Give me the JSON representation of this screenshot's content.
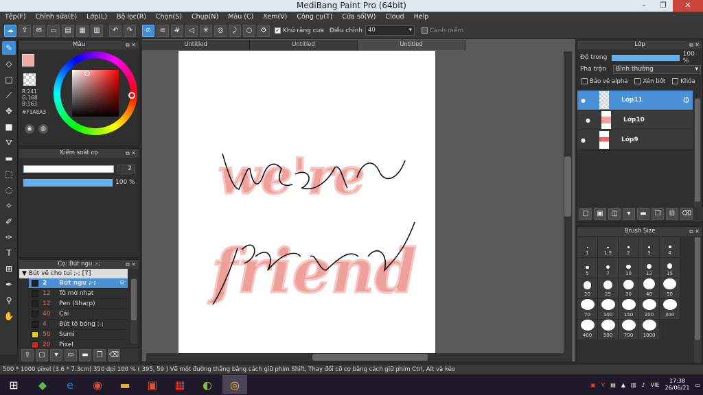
{
  "window": {
    "title": "MediBang Paint Pro (64bit)",
    "min": "–",
    "max": "❐",
    "close": "✕"
  },
  "menu": [
    "Tệp(F)",
    "Chỉnh sửa(E)",
    "Lớp(L)",
    "Bộ lọc(R)",
    "Chọn(S)",
    "Chụp(N)",
    "Màu (C)",
    "Xem(V)",
    "Công cụ(T)",
    "Cửa sổ(W)",
    "Cloud",
    "Help"
  ],
  "toolbar": {
    "antialias": "Khử răng cưa",
    "adjust": "Điều chỉnh",
    "adjust_value": "40",
    "guide": "Canh mềm"
  },
  "color_panel": {
    "title": "Màu",
    "r": "R:241",
    "g": "G:168",
    "b": "B:163",
    "hex": "#F1A8A3",
    "main_color": "#f1a8a3"
  },
  "brush_control": {
    "title": "Kiểm soát cọ",
    "size": "2",
    "opacity": "100 %"
  },
  "brush_panel": {
    "title": "Cọ: Bút ngu ;-;",
    "group": "Bút vẽ cho tui ;-; [7]",
    "items": [
      {
        "size": "2",
        "name": "Bút ngu ;-;",
        "color": "#222222"
      },
      {
        "size": "12",
        "name": "Tô mờ nhạt",
        "color": "#222222"
      },
      {
        "size": "12",
        "name": "Pen (Sharp)",
        "color": "#222222"
      },
      {
        "size": "40",
        "name": "Cái",
        "color": "#222222"
      },
      {
        "size": "4",
        "name": "Bút tô bóng ;-;",
        "color": "#222222"
      },
      {
        "size": "50",
        "name": "Sumi",
        "color": "#e8d000"
      },
      {
        "size": "20",
        "name": "Pixel",
        "color": "#d02020"
      }
    ]
  },
  "doc_tabs": [
    "Untitled",
    "Untitled",
    "Untitled"
  ],
  "artwork": {
    "line1": "we're",
    "line2": "friend"
  },
  "layer_panel": {
    "title": "Lớp",
    "opacity_label": "Độ trong",
    "opacity_value": "100 %",
    "blend_label": "Pha trộn",
    "blend_value": "Bình thường",
    "protect_alpha": "Bảo vệ alpha",
    "clip": "Xén bớt",
    "lock": "Khóa",
    "layers": [
      {
        "name": "Lớp11"
      },
      {
        "name": "Lớp10"
      },
      {
        "name": "Lớp9"
      }
    ]
  },
  "brush_size": {
    "title": "Brush Size",
    "sizes": [
      "1",
      "1.5",
      "2",
      "3",
      "4",
      "5",
      "7",
      "10",
      "12",
      "15",
      "20",
      "25",
      "30",
      "40",
      "50",
      "70",
      "100",
      "150",
      "200",
      "300",
      "400",
      "500",
      "700",
      "1000"
    ]
  },
  "status": {
    "text": "500 * 1000 pixel   (3.6 * 7.3cm)   350 dpi   100 %   ( 395, 59 )   Vẽ một đường thẳng bằng cách giữ phím Shift, Thay đổi cỡ cọ bằng cách giữ phím Ctrl, Alt và kéo"
  },
  "tray": {
    "lang": "VIE",
    "time": "17:38",
    "date": "26/06/21"
  }
}
